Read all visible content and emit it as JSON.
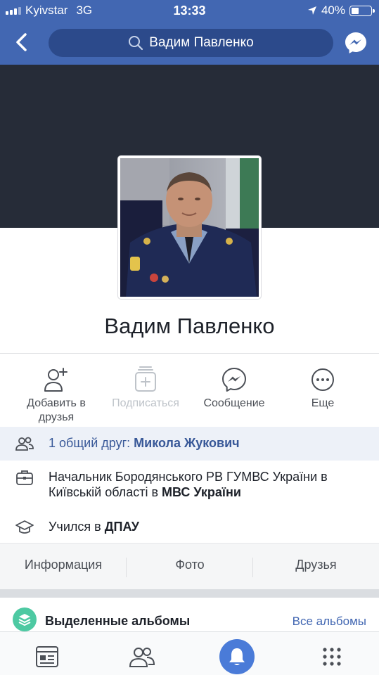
{
  "status_bar": {
    "carrier": "Kyivstar",
    "network": "3G",
    "time": "13:33",
    "battery": "40%",
    "battery_level": 0.4
  },
  "nav": {
    "search_text": "Вадим Павленко",
    "back_icon": "chevron-left-icon",
    "messenger_icon": "messenger-icon"
  },
  "profile": {
    "name": "Вадим Павленко"
  },
  "actions": [
    {
      "label": "Добавить в друзья",
      "icon": "add-friend-icon",
      "enabled": true
    },
    {
      "label": "Подписаться",
      "icon": "follow-icon",
      "enabled": false
    },
    {
      "label": "Сообщение",
      "icon": "messenger-icon",
      "enabled": true
    },
    {
      "label": "Еще",
      "icon": "more-icon",
      "enabled": true
    }
  ],
  "mutual": {
    "prefix": "1 общий друг: ",
    "friend": "Микола Жукович"
  },
  "work": {
    "text": "Начальник Бородянського РВ ГУМВС України в Київській області в ",
    "org": "МВС України"
  },
  "education": {
    "prefix": "Учился в ",
    "school": "ДПАУ"
  },
  "tabs": [
    "Информация",
    "Фото",
    "Друзья"
  ],
  "albums": {
    "title": "Выделенные альбомы",
    "link": "Все альбомы"
  },
  "bottom_tabs": [
    {
      "icon": "news-feed-icon",
      "active": false
    },
    {
      "icon": "friends-icon",
      "active": false
    },
    {
      "icon": "notifications-bell-icon",
      "active": true
    },
    {
      "icon": "menu-grid-icon",
      "active": false
    }
  ],
  "colors": {
    "brand": "#4267b2",
    "cover": "#262c38",
    "link": "#385898",
    "album_icon": "#4dc9a2"
  }
}
